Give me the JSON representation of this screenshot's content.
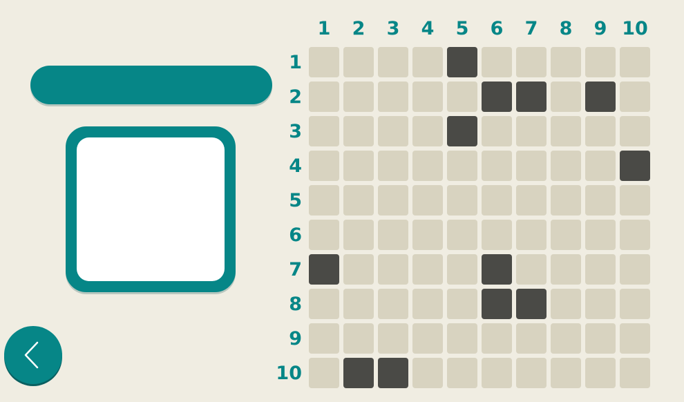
{
  "puzzle": {
    "title": "",
    "columns": [
      "1",
      "2",
      "3",
      "4",
      "5",
      "6",
      "7",
      "8",
      "9",
      "10"
    ],
    "rows": [
      "1",
      "2",
      "3",
      "4",
      "5",
      "6",
      "7",
      "8",
      "9",
      "10"
    ],
    "grid": [
      [
        0,
        0,
        0,
        0,
        1,
        0,
        0,
        0,
        0,
        0
      ],
      [
        0,
        0,
        0,
        0,
        0,
        1,
        1,
        0,
        1,
        0
      ],
      [
        0,
        0,
        0,
        0,
        1,
        0,
        0,
        0,
        0,
        0
      ],
      [
        0,
        0,
        0,
        0,
        0,
        0,
        0,
        0,
        0,
        1
      ],
      [
        0,
        0,
        0,
        0,
        0,
        0,
        0,
        0,
        0,
        0
      ],
      [
        0,
        0,
        0,
        0,
        0,
        0,
        0,
        0,
        0,
        0
      ],
      [
        1,
        0,
        0,
        0,
        0,
        1,
        0,
        0,
        0,
        0
      ],
      [
        0,
        0,
        0,
        0,
        0,
        1,
        1,
        0,
        0,
        0
      ],
      [
        0,
        0,
        0,
        0,
        0,
        0,
        0,
        0,
        0,
        0
      ],
      [
        0,
        1,
        1,
        0,
        0,
        0,
        0,
        0,
        0,
        0
      ]
    ]
  },
  "colors": {
    "accent": "#068687",
    "background": "#f0ede2",
    "cell_empty": "#d8d3c0",
    "cell_filled": "#4a4a46"
  },
  "back_button": {
    "icon": "chevron-left-icon"
  }
}
